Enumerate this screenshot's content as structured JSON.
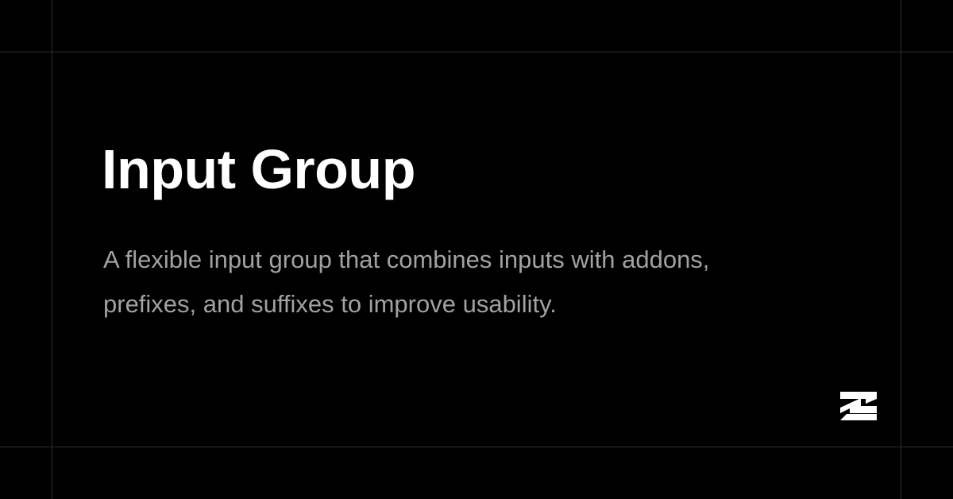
{
  "page": {
    "title": "Input Group",
    "description": "A flexible input group that combines inputs with addons, prefixes, and suffixes to improve usability.",
    "logo_icon": "brand-logo-icon"
  },
  "colors": {
    "background": "#000000",
    "title": "#ffffff",
    "description": "#a1a1a1",
    "grid_line": "#2e2e2e",
    "logo": "#ffffff"
  }
}
